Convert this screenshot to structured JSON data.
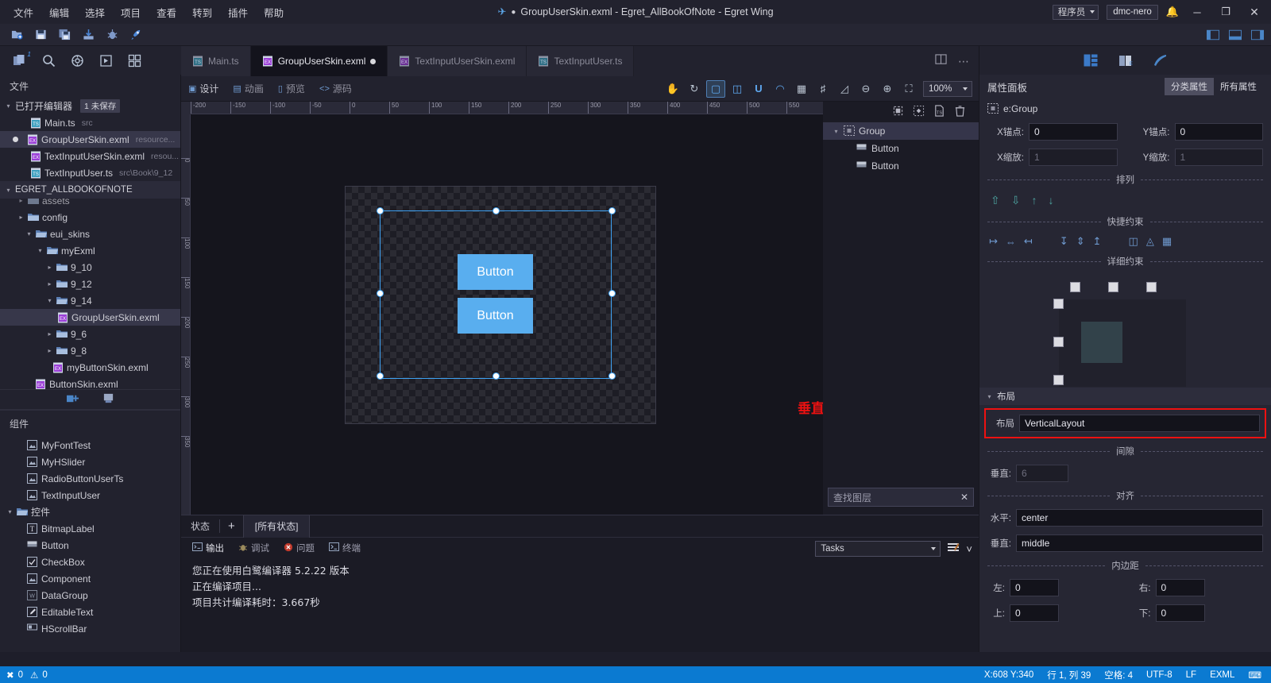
{
  "window": {
    "title": "GroupUserSkin.exml - Egret_AllBookOfNote - Egret Wing",
    "user_role": "程序员",
    "user_name": "dmc-nero",
    "minimize": "─",
    "maximize": "❐",
    "close": "✕"
  },
  "menu": {
    "items": [
      "文件",
      "编辑",
      "选择",
      "项目",
      "查看",
      "转到",
      "插件",
      "帮助"
    ]
  },
  "toolbar": {
    "icons": [
      "new-file-icon",
      "save-icon",
      "save-all-icon",
      "import-icon",
      "debug-icon",
      "run-icon"
    ]
  },
  "activity_rail": {
    "items": [
      "explorer-icon",
      "search-icon",
      "scm-icon",
      "debug-icon",
      "extensions-icon"
    ],
    "badge": "1"
  },
  "sidebar": {
    "header": "文件",
    "opened_editors": {
      "label": "已打开编辑器",
      "badge": "1 未保存",
      "items": [
        {
          "name": "Main.ts",
          "path": "src",
          "modified": false
        },
        {
          "name": "GroupUserSkin.exml",
          "path": "resource...",
          "modified": true
        },
        {
          "name": "TextInputUserSkin.exml",
          "path": "resou...",
          "modified": false
        },
        {
          "name": "TextInputUser.ts",
          "path": "src\\Book\\9_12",
          "modified": false
        }
      ]
    },
    "project": {
      "label": "EGRET_ALLBOOKOFNOTE",
      "items": [
        {
          "label": "assets",
          "depth": 1,
          "type": "folder",
          "state": "collapsed"
        },
        {
          "label": "config",
          "depth": 1,
          "type": "folder",
          "state": "collapsed"
        },
        {
          "label": "eui_skins",
          "depth": 1,
          "type": "folder",
          "state": "expanded"
        },
        {
          "label": "myExml",
          "depth": 2,
          "type": "folder",
          "state": "expanded"
        },
        {
          "label": "9_10",
          "depth": 3,
          "type": "folder",
          "state": "collapsed"
        },
        {
          "label": "9_12",
          "depth": 3,
          "type": "folder",
          "state": "collapsed"
        },
        {
          "label": "9_14",
          "depth": 3,
          "type": "folder",
          "state": "expanded"
        },
        {
          "label": "GroupUserSkin.exml",
          "depth": 4,
          "type": "exml",
          "state": "selected"
        },
        {
          "label": "9_6",
          "depth": 3,
          "type": "folder",
          "state": "collapsed"
        },
        {
          "label": "9_8",
          "depth": 3,
          "type": "folder",
          "state": "collapsed"
        },
        {
          "label": "myButtonSkin.exml",
          "depth": 3,
          "type": "exml",
          "state": "none"
        },
        {
          "label": "ButtonSkin.exml",
          "depth": 2,
          "type": "exml",
          "state": "none"
        }
      ]
    },
    "components": {
      "header": "组件",
      "items": [
        {
          "label": "MyFontTest",
          "type": "component",
          "depth": 1
        },
        {
          "label": "MyHSlider",
          "type": "component",
          "depth": 1
        },
        {
          "label": "RadioButtonUserTs",
          "type": "component",
          "depth": 1
        },
        {
          "label": "TextInputUser",
          "type": "component",
          "depth": 1
        },
        {
          "label": "控件",
          "type": "folder",
          "depth": 0
        },
        {
          "label": "BitmapLabel",
          "type": "label",
          "depth": 1
        },
        {
          "label": "Button",
          "type": "button",
          "depth": 1
        },
        {
          "label": "CheckBox",
          "type": "checkbox",
          "depth": 1
        },
        {
          "label": "Component",
          "type": "component",
          "depth": 1
        },
        {
          "label": "DataGroup",
          "type": "datagroup",
          "depth": 1
        },
        {
          "label": "EditableText",
          "type": "edit",
          "depth": 1
        },
        {
          "label": "HScrollBar",
          "type": "scrollbar",
          "depth": 1
        }
      ]
    }
  },
  "tabs": [
    {
      "label": "Main.ts",
      "type": "ts",
      "active": false,
      "modified": false
    },
    {
      "label": "GroupUserSkin.exml",
      "type": "exml",
      "active": true,
      "modified": true
    },
    {
      "label": "TextInputUserSkin.exml",
      "type": "exml",
      "active": false,
      "modified": false
    },
    {
      "label": "TextInputUser.ts",
      "type": "ts",
      "active": false,
      "modified": false
    }
  ],
  "design_toolbar": {
    "modes": [
      "设计",
      "动画",
      "预览",
      "源码"
    ],
    "active_mode": "设计",
    "tools": [
      "hand-tool-icon",
      "refresh-icon",
      "frame-icon",
      "layout-icon",
      "curve-icon",
      "corner-icon",
      "grid-icon",
      "snap-icon",
      "ruler-icon"
    ],
    "active_tool": "frame-icon",
    "zoom_out": "zoom-out-icon",
    "zoom_in": "zoom-in-icon",
    "zoom_fit": "zoom-fit-icon",
    "zoom_value": "100%"
  },
  "canvas": {
    "ruler_h": [
      "-200",
      "-150",
      "-100",
      "-50",
      "0",
      "50",
      "100",
      "150",
      "200",
      "250",
      "300",
      "350",
      "400",
      "450",
      "500",
      "550"
    ],
    "ruler_v": [
      "0",
      "50",
      "100",
      "150",
      "200",
      "250",
      "300",
      "350"
    ],
    "elements": [
      {
        "label": "Button",
        "name": "button-1"
      },
      {
        "label": "Button",
        "name": "button-2"
      }
    ],
    "annotation": "垂直布局方式",
    "annotation_color": "#ee1111"
  },
  "layers": {
    "tools": [
      "select-icon",
      "group-icon",
      "create-ts-icon",
      "delete-icon"
    ],
    "tree": [
      {
        "label": "Group",
        "depth": 0,
        "selected": true,
        "icon": "group-icon"
      },
      {
        "label": "Button",
        "depth": 1,
        "selected": false,
        "icon": "button-icon"
      },
      {
        "label": "Button",
        "depth": 1,
        "selected": false,
        "icon": "button-icon"
      }
    ],
    "search_placeholder": "查找图层",
    "clear": "✕"
  },
  "bottom_panel": {
    "state_label": "状态",
    "add": "+",
    "all_states": "[所有状态]",
    "tabs": [
      {
        "label": "输出",
        "active": true,
        "icon": "output-icon"
      },
      {
        "label": "调试",
        "active": false,
        "icon": "debug-icon"
      },
      {
        "label": "问题",
        "active": false,
        "icon": "problem-icon"
      },
      {
        "label": "终端",
        "active": false,
        "icon": "terminal-icon"
      }
    ],
    "output_lines": [
      "您正在使用白鹭编译器 5.2.22 版本",
      "正在编译项目...",
      "项目共计编译耗时：3.667秒"
    ],
    "task_select": "Tasks",
    "clear_output_icon": "clear-output-icon",
    "collapse_icon": "chevron-down-icon"
  },
  "properties": {
    "panel_icons": [
      "properties-icon",
      "help-icon",
      "feather-icon"
    ],
    "title": "属性面板",
    "seg_category": "分类属性",
    "seg_all": "所有属性",
    "object_type": "e:Group",
    "fields": {
      "x_anchor_label": "X锚点:",
      "x_anchor_value": "0",
      "y_anchor_label": "Y锚点:",
      "y_anchor_value": "0",
      "x_scale_label": "X缩放:",
      "x_scale_value": "1",
      "y_scale_label": "Y缩放:",
      "y_scale_value": "1"
    },
    "sections": {
      "arrange": "排列",
      "quick_constraint": "快捷约束",
      "detail_constraint": "详细约束",
      "layout": "布局",
      "gap": "间隙",
      "align": "对齐",
      "padding": "内边距"
    },
    "layout": {
      "label": "布局",
      "value": "VerticalLayout",
      "highlight_color": "#ee1111"
    },
    "gap": {
      "vertical_label": "垂直:",
      "vertical_value": "6"
    },
    "align": {
      "horizontal_label": "水平:",
      "horizontal_value": "center",
      "vertical_label": "垂直:",
      "vertical_value": "middle"
    },
    "padding": {
      "left_label": "左:",
      "left_value": "0",
      "right_label": "右:",
      "right_value": "0",
      "top_label": "上:",
      "top_value": "0",
      "bottom_label": "下:",
      "bottom_value": "0"
    }
  },
  "statusbar": {
    "errors": "0",
    "warnings": "0",
    "position": "X:608 Y:340",
    "cursor": "行 1, 列 39",
    "indent": "空格: 4",
    "encoding": "UTF-8",
    "eol": "LF",
    "language": "EXML",
    "keyboard_icon": "keyboard-icon"
  }
}
